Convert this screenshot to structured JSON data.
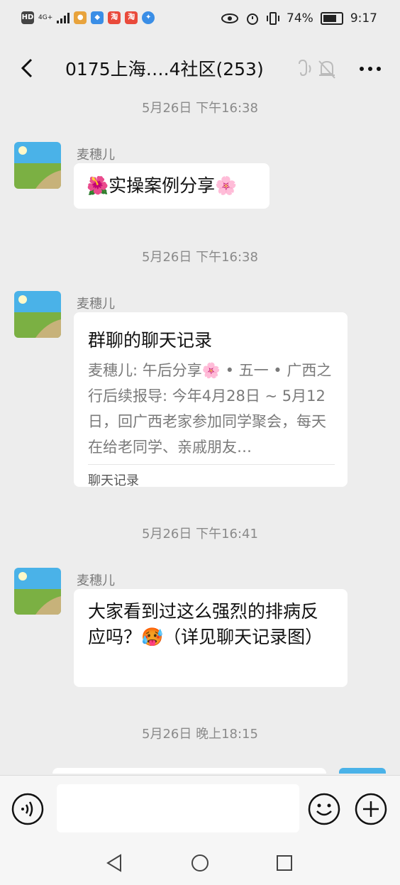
{
  "status_bar": {
    "left_badges": [
      "HD",
      "4G+"
    ],
    "battery": "74%",
    "battery_level": 0.74,
    "time": "9:17"
  },
  "header": {
    "title": "0175上海….4社区(253)",
    "icons": [
      "back-icon",
      "earpiece-icon",
      "mute-bell-icon",
      "more-icon"
    ]
  },
  "messages": [
    {
      "timestamp": "5月26日 下午16:38",
      "sender": "麦穗儿",
      "type": "text",
      "text": "🌺实操案例分享🌸"
    },
    {
      "timestamp": "5月26日 下午16:38",
      "sender": "麦穗儿",
      "type": "chat-record",
      "card_title": "群聊的聊天记录",
      "card_preview": "麦穗儿: 午后分享🌸 • 五一 • 广西之行后续报导:   今年4月28日 ~ 5月12日，回广西老家参加同学聚会，每天在给老同学、亲戚朋友…",
      "card_footer": "聊天记录"
    },
    {
      "timestamp": "5月26日 下午16:41",
      "sender": "麦穗儿",
      "type": "text",
      "text": "大家看到过这么强烈的排病反应吗？🥵（详见聊天记录图）"
    },
    {
      "timestamp": "5月26日 晚上18:15"
    }
  ],
  "input_bar": {
    "placeholder": "",
    "icons": [
      "voice-icon",
      "emoji-icon",
      "plus-icon"
    ]
  },
  "system_nav": {
    "icons": [
      "back-triangle-icon",
      "home-circle-icon",
      "recents-square-icon"
    ]
  },
  "colors": {
    "background": "#ededed",
    "bubble": "#ffffff",
    "timestamp": "#8a8a8a",
    "sender": "#7a7a7a"
  }
}
